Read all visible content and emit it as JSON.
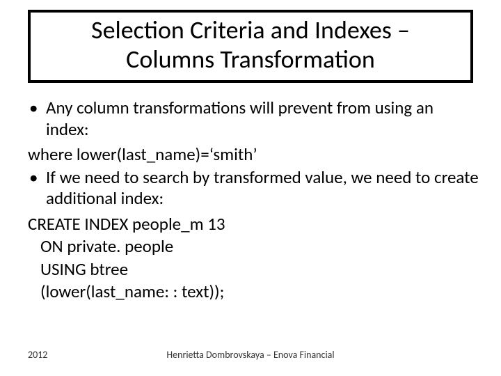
{
  "title": {
    "line1": "Selection Criteria and Indexes –",
    "line2": "Columns Transformation"
  },
  "body": {
    "bullet1": "Any column transformations will prevent from using an index:",
    "line_where": "where lower(last_name)=‘smith’",
    "bullet2": "If we need to search by transformed value, we need to create additional index:",
    "sql1": "CREATE INDEX people_m 13",
    "sql2": "ON private. people",
    "sql3": "USING btree",
    "sql4": "(lower(last_name: : text));"
  },
  "footer": {
    "year": "2012",
    "credit": "Henrietta Dombrovskaya – Enova Financial"
  }
}
